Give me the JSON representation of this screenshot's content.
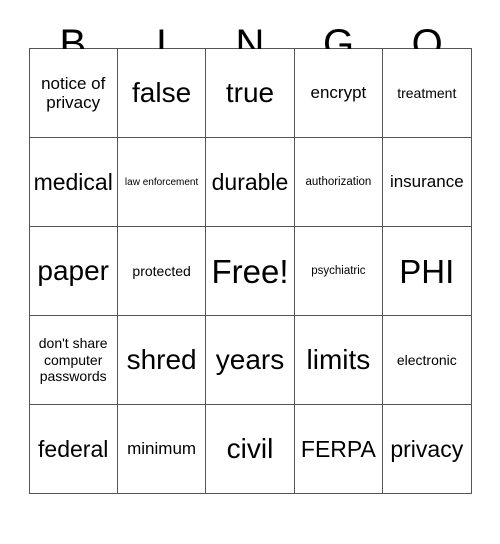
{
  "card": {
    "headers": [
      "B",
      "I",
      "N",
      "G",
      "O"
    ],
    "rows": [
      [
        {
          "text": "notice of privacy",
          "size": "md"
        },
        {
          "text": "false",
          "size": "xl"
        },
        {
          "text": "true",
          "size": "xl"
        },
        {
          "text": "encrypt",
          "size": "md"
        },
        {
          "text": "treatment",
          "size": "sm"
        }
      ],
      [
        {
          "text": "medical",
          "size": "lg"
        },
        {
          "text": "law enforcement",
          "size": "xxs"
        },
        {
          "text": "durable",
          "size": "lg"
        },
        {
          "text": "authorization",
          "size": "xs"
        },
        {
          "text": "insurance",
          "size": "md"
        }
      ],
      [
        {
          "text": "paper",
          "size": "xl"
        },
        {
          "text": "protected",
          "size": "sm"
        },
        {
          "text": "Free!",
          "size": "xxl"
        },
        {
          "text": "psychiatric",
          "size": "xs"
        },
        {
          "text": "PHI",
          "size": "xxl"
        }
      ],
      [
        {
          "text": "don't share computer passwords",
          "size": "sm"
        },
        {
          "text": "shred",
          "size": "xl"
        },
        {
          "text": "years",
          "size": "xl"
        },
        {
          "text": "limits",
          "size": "xl"
        },
        {
          "text": "electronic",
          "size": "sm"
        }
      ],
      [
        {
          "text": "federal",
          "size": "lg"
        },
        {
          "text": "minimum",
          "size": "md"
        },
        {
          "text": "civil",
          "size": "xl"
        },
        {
          "text": "FERPA",
          "size": "lg"
        },
        {
          "text": "privacy",
          "size": "lg"
        }
      ]
    ]
  },
  "colors": {
    "border": "#555555",
    "text": "#000000",
    "background": "#ffffff"
  }
}
